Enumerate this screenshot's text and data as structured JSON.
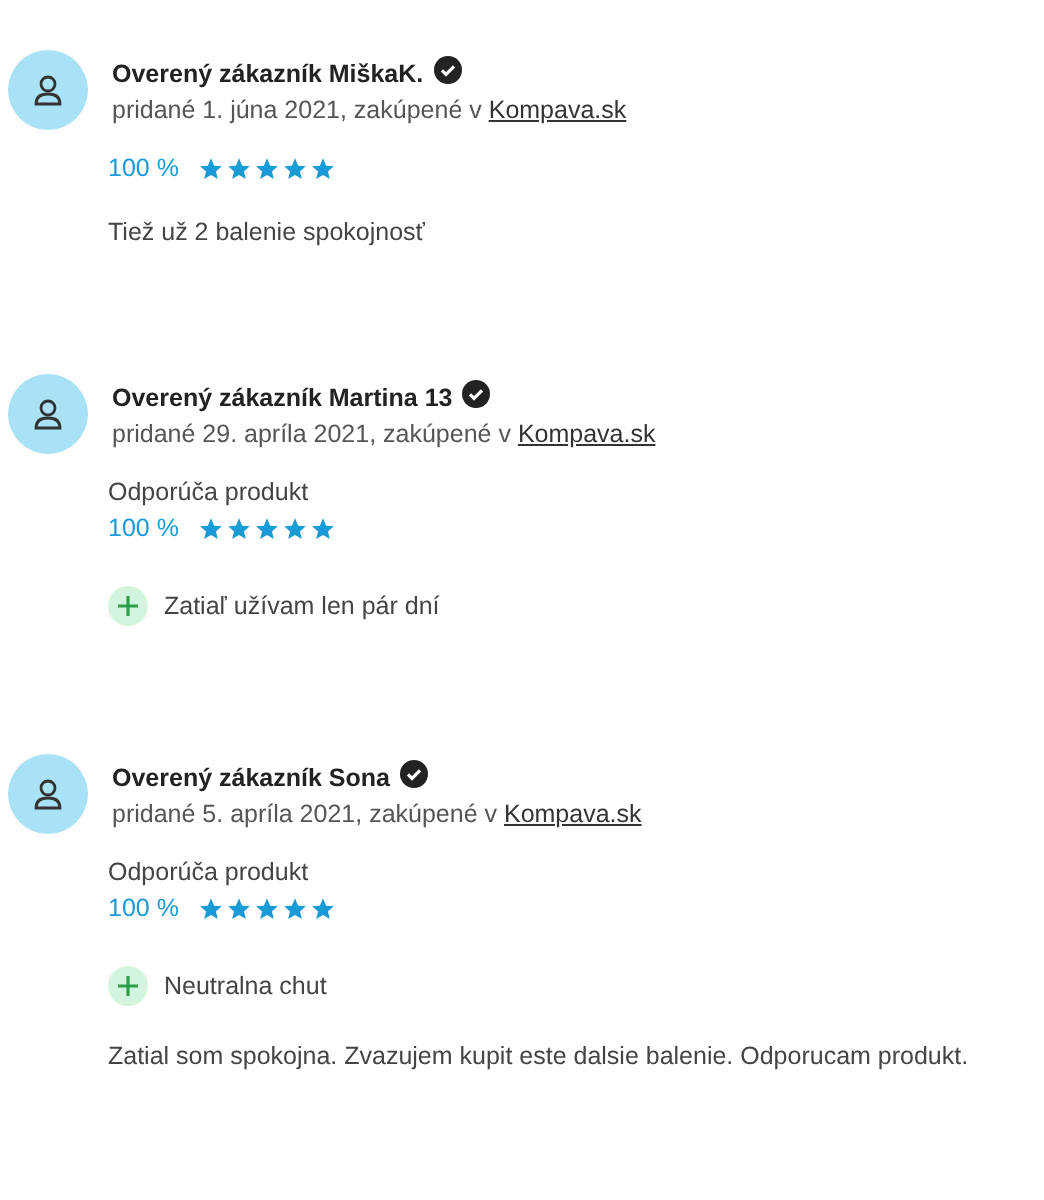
{
  "reviews": [
    {
      "author": "Overený zákazník MiškaK.",
      "verified": true,
      "meta": "pridané 1. júna 2021, zakúpené v",
      "store": "Kompava.sk",
      "score": "100 %",
      "stars": 5,
      "comment": "Tiež už 2 balenie spokojnosť"
    },
    {
      "author": "Overený zákazník Martina 13",
      "verified": true,
      "meta": "pridané 29. apríla 2021, zakúpené v",
      "store": "Kompava.sk",
      "recommendation": "Odporúča produkt",
      "score": "100 %",
      "stars": 5,
      "pros": [
        "Zatiaľ užívam len pár dní"
      ]
    },
    {
      "author": "Overený zákazník Sona",
      "verified": true,
      "meta": "pridané 5. apríla 2021, zakúpené v",
      "store": "Kompava.sk",
      "recommendation": "Odporúča produkt",
      "score": "100 %",
      "stars": 5,
      "pros": [
        "Neutralna chut"
      ],
      "comment": "Zatial som spokojna. Zvazujem kupit este dalsie balenie. Odporucam produkt."
    }
  ]
}
